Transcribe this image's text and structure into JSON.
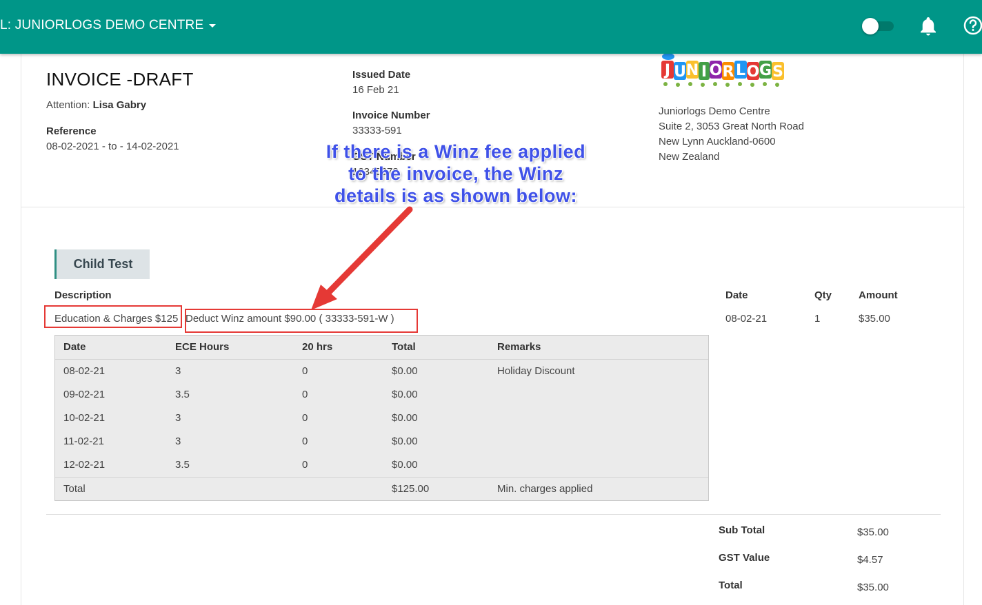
{
  "header": {
    "centre_name": "L: JUNIORLOGS DEMO CENTRE",
    "brand_color": "#009688"
  },
  "invoice": {
    "title": "INVOICE -DRAFT",
    "attention_label": "Attention:",
    "attention_name": "Lisa Gabry",
    "reference_label": "Reference",
    "reference_value": "08-02-2021 - to - 14-02-2021",
    "issued_date_label": "Issued Date",
    "issued_date_value": "16 Feb 21",
    "invoice_number_label": "Invoice Number",
    "invoice_number_value": "33333-591",
    "gst_number_label": "GST Number",
    "gst_number_value": "12345678"
  },
  "centre": {
    "logo_text": "JUNIORLOGS",
    "name": "Juniorlogs Demo Centre",
    "address_line1": "Suite 2, 3053 Great North Road",
    "address_line2": "New Lynn Auckland-0600",
    "country": "New Zealand"
  },
  "annotation": {
    "text_line1": "If there is a Winz fee applied",
    "text_line2": "to the invoice, the Winz",
    "text_line3": "details is as shown below:",
    "color": "#3f51e8",
    "highlight_color": "#e53935"
  },
  "child": {
    "tab_label": "Child Test"
  },
  "line_items": {
    "headers": {
      "description": "Description",
      "date": "Date",
      "qty": "Qty",
      "amount": "Amount"
    },
    "item": {
      "description": "Education & Charges $125",
      "winz": "Deduct Winz amount $90.00 ( 33333-591-W )",
      "date": "08-02-21",
      "qty": "1",
      "amount": "$35.00"
    }
  },
  "attendance": {
    "headers": [
      "Date",
      "ECE Hours",
      "20 hrs",
      "Total",
      "Remarks"
    ],
    "rows": [
      [
        "08-02-21",
        "3",
        "0",
        "$0.00",
        "Holiday Discount"
      ],
      [
        "09-02-21",
        "3.5",
        "0",
        "$0.00",
        ""
      ],
      [
        "10-02-21",
        "3",
        "0",
        "$0.00",
        ""
      ],
      [
        "11-02-21",
        "3",
        "0",
        "$0.00",
        ""
      ],
      [
        "12-02-21",
        "3.5",
        "0",
        "$0.00",
        ""
      ]
    ],
    "total": [
      "Total",
      "",
      "",
      "$125.00",
      "Min. charges applied"
    ]
  },
  "totals": {
    "subtotal_label": "Sub Total",
    "subtotal_value": "$35.00",
    "gst_label": "GST Value",
    "gst_value": "$4.57",
    "total_label": "Total",
    "total_value": "$35.00"
  }
}
